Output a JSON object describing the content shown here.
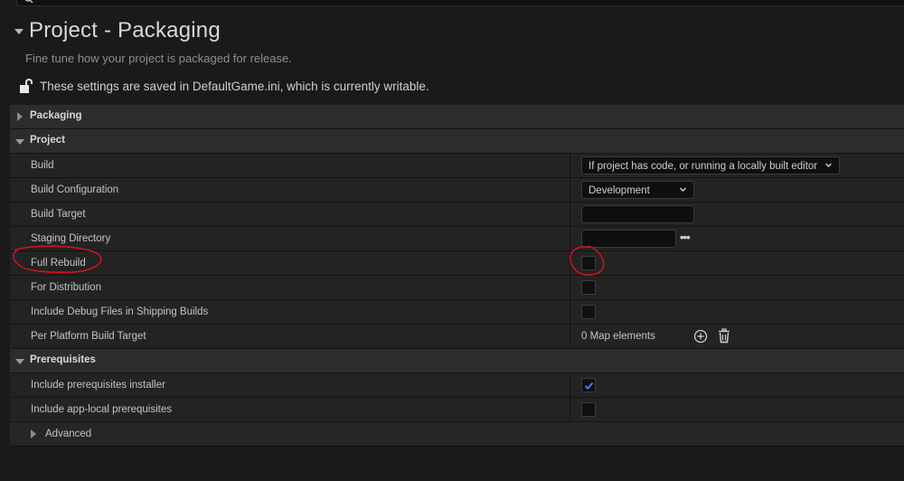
{
  "header": {
    "title": "Project - Packaging",
    "subtitle": "Fine tune how your project is packaged for release.",
    "save_note": "These settings are saved in DefaultGame.ini, which is currently writable."
  },
  "sections": {
    "packaging": {
      "label": "Packaging",
      "expanded": false
    },
    "project": {
      "label": "Project",
      "expanded": true,
      "build": {
        "label": "Build",
        "value": "If project has code, or running a locally built editor"
      },
      "build_configuration": {
        "label": "Build Configuration",
        "value": "Development"
      },
      "build_target": {
        "label": "Build Target",
        "value": ""
      },
      "staging_directory": {
        "label": "Staging Directory",
        "value": "",
        "browse": "•••"
      },
      "full_rebuild": {
        "label": "Full Rebuild",
        "checked": false
      },
      "for_distribution": {
        "label": "For Distribution",
        "checked": false
      },
      "include_debug_files": {
        "label": "Include Debug Files in Shipping Builds",
        "checked": false
      },
      "per_platform_build_target": {
        "label": "Per Platform Build Target",
        "value": "0 Map elements"
      }
    },
    "prerequisites": {
      "label": "Prerequisites",
      "expanded": true,
      "include_installer": {
        "label": "Include prerequisites installer",
        "checked": true
      },
      "include_app_local": {
        "label": "Include app-local prerequisites",
        "checked": false
      }
    },
    "advanced": {
      "label": "Advanced",
      "expanded": false
    }
  },
  "icons": {
    "search": "search-icon",
    "lock": "unlocked-padlock-icon",
    "add": "add-element-icon",
    "delete": "trash-icon",
    "chevron": "chevron-down-icon"
  },
  "colors": {
    "checkbox_check": "#2f8cf0",
    "annotation": "#d8151c"
  }
}
